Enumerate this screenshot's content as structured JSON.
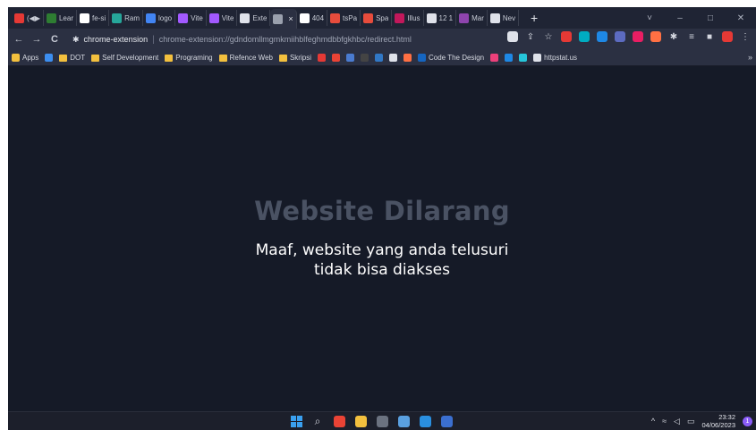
{
  "tabs": [
    {
      "label": "(◀▶",
      "color": "#e53935"
    },
    {
      "label": "Lear",
      "color": "#2e7d32"
    },
    {
      "label": "fe-si",
      "color": "#ffffff"
    },
    {
      "label": "Ram",
      "color": "#26a69a"
    },
    {
      "label": "logo",
      "color": "#4285f4"
    },
    {
      "label": "Vite",
      "color": "#a259ff"
    },
    {
      "label": "Vite",
      "color": "#a259ff"
    },
    {
      "label": "Exte",
      "color": "#dfe2ea"
    },
    {
      "label": "",
      "color": "#9aa0ad",
      "active": true
    },
    {
      "label": "404",
      "color": "#ffffff"
    },
    {
      "label": "tsPa",
      "color": "#e74c3c"
    },
    {
      "label": "Spa",
      "color": "#e74c3c"
    },
    {
      "label": "Illus",
      "color": "#c2185b"
    },
    {
      "label": "12 1",
      "color": "#dfe2ea"
    },
    {
      "label": "Mar",
      "color": "#8e44ad"
    },
    {
      "label": "Nev",
      "color": "#dfe2ea"
    }
  ],
  "active_tab_close": "×",
  "new_tab": "+",
  "window_controls": {
    "dropdown": "˅",
    "minimize": "–",
    "maximize": "□",
    "close": "✕"
  },
  "nav": {
    "back": "←",
    "forward": "→",
    "reload": "C"
  },
  "omnibox": {
    "host": "chrome-extension",
    "separator": "|",
    "url": "chrome-extension://gdndomllmgmkmiihblfeghmdbbfgkhbc/redirect.html"
  },
  "toolbar_icons": [
    {
      "name": "google-lens-icon",
      "color": "#dfe2ea"
    },
    {
      "name": "share-icon",
      "glyph": "⇪"
    },
    {
      "name": "bookmark-star-icon",
      "glyph": "☆"
    },
    {
      "name": "ext-opera-icon",
      "color": "#e53935"
    },
    {
      "name": "ext-one-icon",
      "color": "#00acc1"
    },
    {
      "name": "ext-two-icon",
      "color": "#1e88e5"
    },
    {
      "name": "ext-three-icon",
      "color": "#5c6bc0"
    },
    {
      "name": "ext-four-icon",
      "color": "#e91e63"
    },
    {
      "name": "ext-five-icon",
      "color": "#ff7043"
    },
    {
      "name": "extensions-puzzle-icon",
      "glyph": "✱"
    },
    {
      "name": "reading-list-icon",
      "glyph": "≡"
    },
    {
      "name": "side-panel-icon",
      "glyph": "■"
    },
    {
      "name": "profile-avatar-icon",
      "color": "#e53935"
    },
    {
      "name": "menu-icon",
      "glyph": "⋮"
    }
  ],
  "bookmarks": [
    {
      "name": "bookmark-apps",
      "label": "Apps",
      "color": "#f3c03e"
    },
    {
      "name": "bookmark-icon-one",
      "label": "",
      "color": "#3c8ef0"
    },
    {
      "name": "bookmark-dot",
      "label": "DOT",
      "folder": true
    },
    {
      "name": "bookmark-self-development",
      "label": "Self Development",
      "folder": true
    },
    {
      "name": "bookmark-programing",
      "label": "Programing",
      "folder": true
    },
    {
      "name": "bookmark-refence-web",
      "label": "Refence Web",
      "folder": true
    },
    {
      "name": "bookmark-skripsi",
      "label": "Skripsi",
      "folder": true
    },
    {
      "name": "bookmark-red",
      "label": "",
      "color": "#e53935"
    },
    {
      "name": "bookmark-gmail",
      "label": "",
      "color": "#ea4335"
    },
    {
      "name": "bookmark-blue",
      "label": "",
      "color": "#4a7bd0"
    },
    {
      "name": "bookmark-dev",
      "label": "",
      "color": "#444444"
    },
    {
      "name": "bookmark-ts",
      "label": "",
      "color": "#3178c6"
    },
    {
      "name": "bookmark-github",
      "label": "",
      "color": "#dfe2ea"
    },
    {
      "name": "bookmark-orange",
      "label": "",
      "color": "#ff7043"
    },
    {
      "name": "bookmark-code-the-design",
      "label": "Code The Design",
      "color": "#1565c0"
    },
    {
      "name": "bookmark-pink",
      "label": "",
      "color": "#ec407a"
    },
    {
      "name": "bookmark-small",
      "label": "",
      "color": "#1e88e5"
    },
    {
      "name": "bookmark-cyan",
      "label": "",
      "color": "#26c6da"
    },
    {
      "name": "bookmark-httpstatus",
      "label": "httpstat.us",
      "color": "#dfe2ea"
    }
  ],
  "bookmarks_more": "»",
  "page": {
    "title": "Website Dilarang",
    "message_line1": "Maaf, website yang anda telusuri",
    "message_line2": "tidak bisa diakses"
  },
  "taskbar": {
    "apps": [
      {
        "name": "start-button"
      },
      {
        "name": "taskbar-search-icon",
        "glyph": "⌕"
      },
      {
        "name": "taskbar-chrome-icon",
        "color": "#ea4335"
      },
      {
        "name": "taskbar-file-explorer-icon",
        "color": "#f3c03e"
      },
      {
        "name": "taskbar-terminal-icon",
        "color": "#6b7280"
      },
      {
        "name": "taskbar-photos-icon",
        "color": "#5aa0e0"
      },
      {
        "name": "taskbar-vscode-icon",
        "color": "#2a8fe0"
      },
      {
        "name": "taskbar-word-icon",
        "color": "#3b6fd0"
      }
    ],
    "tray": {
      "chevron": "^",
      "wifi": "≈",
      "volume": "◁",
      "battery": "▭"
    },
    "time": "23:32",
    "date": "04/06/2023",
    "notification_count": "1"
  }
}
